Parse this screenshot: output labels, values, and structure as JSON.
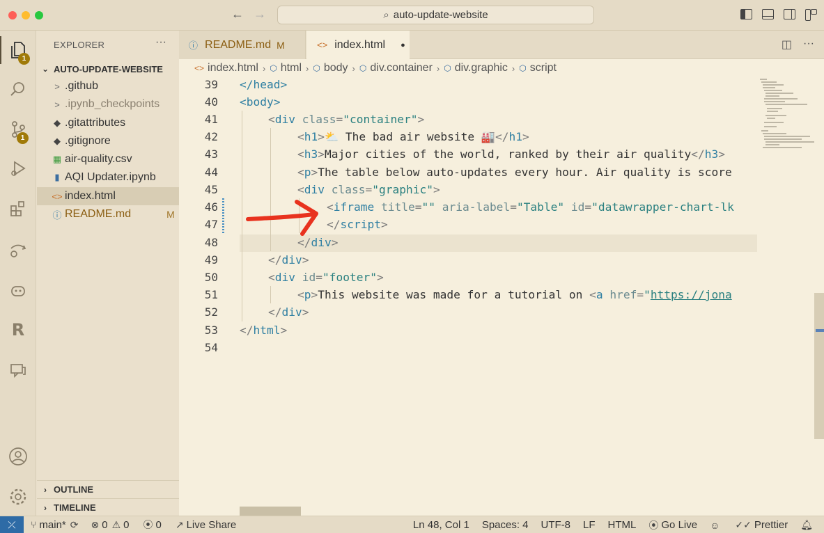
{
  "titlebar": {
    "search_text": "auto-update-website"
  },
  "activity": {
    "explorer_badge": "1",
    "scm_badge": "1"
  },
  "sidebar": {
    "title": "EXPLORER",
    "more": "···",
    "folder": "AUTO-UPDATE-WEBSITE",
    "items": [
      {
        "label": ".github",
        "icon": ">",
        "status": ""
      },
      {
        "label": ".ipynb_checkpoints",
        "icon": ">",
        "status": ""
      },
      {
        "label": ".gitattributes",
        "icon": "◆",
        "status": ""
      },
      {
        "label": ".gitignore",
        "icon": "◆",
        "status": ""
      },
      {
        "label": "air-quality.csv",
        "icon": "▦",
        "status": ""
      },
      {
        "label": "AQI Updater.ipynb",
        "icon": "▮",
        "status": ""
      },
      {
        "label": "index.html",
        "icon": "<>",
        "status": ""
      },
      {
        "label": "README.md",
        "icon": "ⓘ",
        "status": "M"
      }
    ],
    "outline": "OUTLINE",
    "timeline": "TIMELINE"
  },
  "tabs": [
    {
      "label": "README.md",
      "status": "M"
    },
    {
      "label": "index.html",
      "status": "●"
    }
  ],
  "breadcrumb": [
    "index.html",
    "html",
    "body",
    "div.container",
    "div.graphic",
    "script"
  ],
  "editor": {
    "line_numbers": [
      "39",
      "40",
      "41",
      "42",
      "43",
      "44",
      "45",
      "46",
      "47",
      "48",
      "49",
      "50",
      "51",
      "52",
      "53",
      "54"
    ],
    "lines": {
      "l39": "</head>",
      "l40": "<body>",
      "l41_tag": "div",
      "l41_attr": "class",
      "l41_val": "\"container\"",
      "l42_tag": "h1",
      "l42_text": "⛅ The bad air website 🏭",
      "l43_tag": "h3",
      "l43_text": "Major cities of the world, ranked by their air quality",
      "l44_tag": "p",
      "l44_text": "The table below auto-updates every hour. Air quality is score",
      "l45_tag": "div",
      "l45_attr": "class",
      "l45_val": "\"graphic\"",
      "l46_tag": "iframe",
      "l46_a1": "title",
      "l46_v1": "\"\"",
      "l46_a2": "aria-label",
      "l46_v2": "\"Table\"",
      "l46_a3": "id",
      "l46_v3": "\"datawrapper-chart-lk",
      "l47_tag": "script",
      "l48_tag": "div",
      "l49_tag": "div",
      "l50_tag": "div",
      "l50_attr": "id",
      "l50_val": "\"footer\"",
      "l51_tag": "p",
      "l51_text": "This website was made for a tutorial on ",
      "l51_a": "a",
      "l51_attr": "href",
      "l51_url": "https://jona",
      "l52_tag": "div",
      "l53_tag": "html"
    }
  },
  "status": {
    "branch": "main*",
    "errors": "0",
    "warnings": "0",
    "ports": "0",
    "live_share": "Live Share",
    "position": "Ln 48, Col 1",
    "spaces": "Spaces: 4",
    "encoding": "UTF-8",
    "eol": "LF",
    "language": "HTML",
    "go_live": "Go Live",
    "prettier": "Prettier"
  },
  "colors": {
    "accent": "#2e6ba6",
    "annotation_arrow": "#e8321e"
  }
}
